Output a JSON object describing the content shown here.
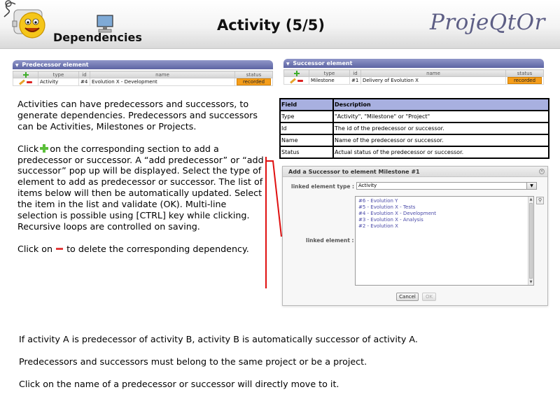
{
  "header": {
    "section_title": "Dependencies",
    "page_title": "Activity (5/5)",
    "brand": "ProjeQtOr"
  },
  "predecessor": {
    "title": "Predecessor element",
    "columns": [
      "type",
      "id",
      "name",
      "status"
    ],
    "row": {
      "type": "Activity",
      "id": "#4",
      "name": "Evolution X - Development",
      "status": "recorded"
    }
  },
  "successor": {
    "title": "Successor element",
    "columns": [
      "type",
      "id",
      "name",
      "status"
    ],
    "row": {
      "type": "Milestone",
      "id": "#1",
      "name": "Delivery of Evolution X",
      "status": "recorded"
    }
  },
  "fields": {
    "header": [
      "Field",
      "Description"
    ],
    "rows": [
      [
        "Type",
        "\"Activity\", \"Milestone\" or \"Project\""
      ],
      [
        "Id",
        "The id of the predecessor or successor."
      ],
      [
        "Name",
        "Name of the predecessor or successor."
      ],
      [
        "Status",
        "Actual status of the predecessor or successor."
      ]
    ]
  },
  "text": {
    "p1": "Activities can have predecessors and successors, to generate dependencies. Predecessors and successors can be Activities, Milestones or Projects.",
    "p2_before": "Click",
    "p2_after": "on the corresponding section to add a predecessor or successor. A “add predecessor” or “add successor” pop up will be displayed. Select the type of element to add as predecessor or successor. The list of items below will then be automatically updated. Select the item in the list and validate (OK). Multi-line selection is possible using [CTRL] key while clicking. Recursive loops are controlled on saving.",
    "p3_before": "Click on",
    "p3_after": "to delete the corresponding dependency.",
    "b1": "If activity A is predecessor of activity B, activity B is automatically successor of activity A.",
    "b2": "Predecessors and successors must belong to the same project or be a project.",
    "b3": "Click on the name of a predecessor or successor will directly move to it."
  },
  "dialog": {
    "title": "Add a Successor to element Milestone #1",
    "type_label": "linked element type :",
    "type_value": "Activity",
    "element_label": "linked element :",
    "items": [
      "#6 - Evolution Y",
      "#5 - Evolution X - Tests",
      "#4 - Evolution X - Development",
      "#3 - Evolution X - Analysis",
      "#2 - Evolution X"
    ],
    "cancel": "Cancel",
    "ok": "OK"
  },
  "colors": {
    "accent": "#5d64a3",
    "brand": "#5d5e85",
    "status": "#f59e1b",
    "bracket": "#e01010"
  },
  "icons": [
    "add-icon",
    "delete-icon",
    "edit-icon",
    "close-icon",
    "search-icon",
    "dropdown-icon"
  ]
}
